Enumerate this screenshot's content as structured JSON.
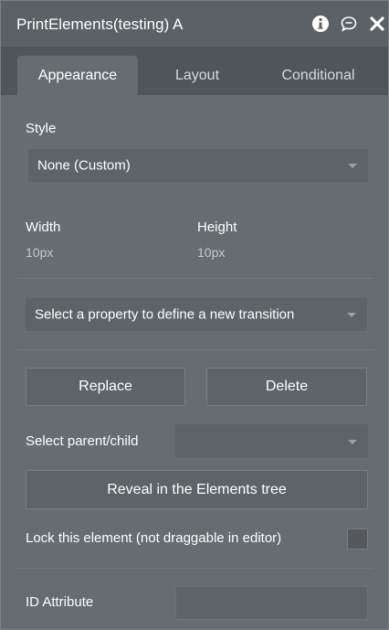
{
  "header": {
    "title": "PrintElements(testing) A",
    "icons": [
      "info-icon",
      "comment-icon",
      "close-icon"
    ]
  },
  "tabs": [
    {
      "label": "Appearance",
      "active": true
    },
    {
      "label": "Layout",
      "active": false
    },
    {
      "label": "Conditional",
      "active": false
    }
  ],
  "style": {
    "label": "Style",
    "selected": "None (Custom)"
  },
  "dimensions": {
    "width_label": "Width",
    "width_value": "10px",
    "height_label": "Height",
    "height_value": "10px"
  },
  "transition": {
    "selected": "Select a property to define a new transition"
  },
  "actions": {
    "replace_label": "Replace",
    "delete_label": "Delete"
  },
  "parent_child": {
    "label": "Select parent/child",
    "selected": ""
  },
  "reveal": {
    "label": "Reveal in the Elements tree"
  },
  "lock": {
    "label": "Lock this element (not draggable in editor)",
    "checked": false
  },
  "id_attribute": {
    "label": "ID Attribute",
    "value": ""
  },
  "colors": {
    "panel": "#666c6f",
    "titlebar": "#5b6164",
    "tabbar": "#4f5558",
    "field": "#5d6366",
    "text": "#ffffff"
  }
}
